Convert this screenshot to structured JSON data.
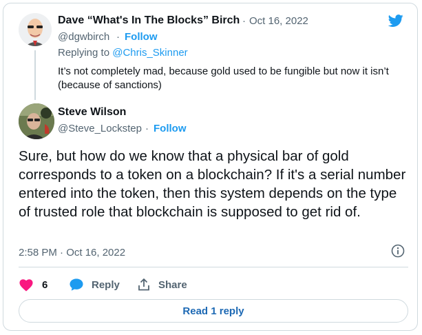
{
  "parent_tweet": {
    "author_name": "Dave “What's In The Blocks” Birch",
    "separator": "·",
    "date": "Oct 16, 2022",
    "handle": "@dgwbirch",
    "follow_label": "Follow",
    "replying_prefix": "Replying to",
    "replying_to": "@Chris_Skinner",
    "text": "It’s not completely mad, because gold used to be fungible but now it isn’t (because of sanctions)"
  },
  "main_tweet": {
    "author_name": "Steve Wilson",
    "handle": "@Steve_Lockstep",
    "separator": "·",
    "follow_label": "Follow",
    "text": "Sure, but how do we know that a physical bar of gold corresponds to a token on a blockchain? If it's a serial number entered into the token, then this system depends on the type of trusted role that blockchain is supposed to get rid of.",
    "timestamp": "2:58 PM · Oct 16, 2022"
  },
  "actions": {
    "likes_count": "6",
    "reply_label": "Reply",
    "share_label": "Share"
  },
  "read_replies_label": "Read 1 reply",
  "colors": {
    "accent": "#1d9bf0",
    "like_red": "#f91880",
    "text": "#0f1419",
    "muted": "#536471",
    "border": "#cfd9de"
  },
  "icons": [
    "twitter-bird-icon",
    "info-icon",
    "heart-icon",
    "reply-bubble-icon",
    "share-icon"
  ]
}
